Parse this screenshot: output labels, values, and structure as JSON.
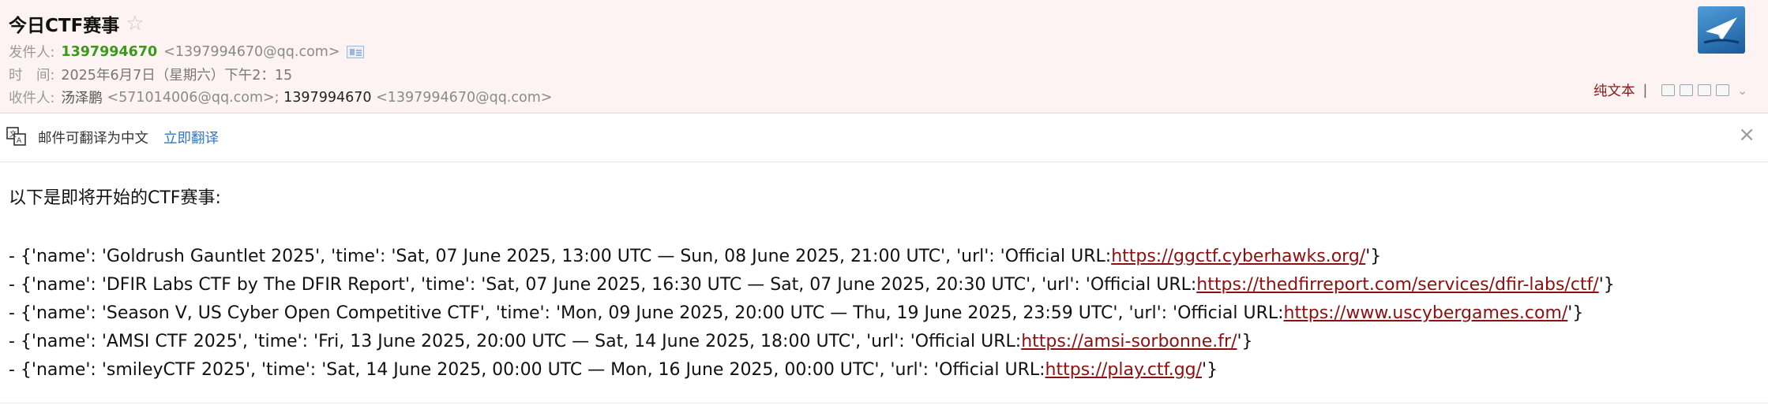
{
  "email": {
    "subject": "今日CTF赛事",
    "star_icon": "star-outline-icon",
    "from_label": "发件人:",
    "from_name": "1397994670",
    "from_address": "<1397994670@qq.com>",
    "time_label": "时　间:",
    "time_value": "2025年6月7日（星期六）下午2：15",
    "to_label": "收件人:",
    "to_name_1": "汤泽鹏",
    "to_address_1": "<571014006@qq.com>;",
    "to_name_2": "1397994670",
    "to_address_2": "<1397994670@qq.com>"
  },
  "toolbar": {
    "plain_text_label": "纯文本",
    "separator": "|",
    "icons": [
      "window-icon",
      "document-icon",
      "folder-add-icon",
      "printer-icon",
      "chevron-down-icon"
    ]
  },
  "translate": {
    "notice": "邮件可翻译为中文",
    "action": "立即翻译",
    "close": "×"
  },
  "body": {
    "intro": "以下是即将开始的CTF赛事:",
    "items": [
      {
        "text": "- {'name': 'Goldrush Gauntlet 2025', 'time': 'Sat, 07 June 2025, 13:00 UTC — Sun, 08 June 2025, 21:00 UTC', 'url': 'Official URL:",
        "link": "https://ggctf.cyberhawks.org/",
        "tail": "'}"
      },
      {
        "text": "- {'name': 'DFIR Labs CTF by The DFIR Report', 'time': 'Sat, 07 June 2025, 16:30 UTC — Sat, 07 June 2025, 20:30 UTC', 'url': 'Official URL:",
        "link": "https://thedfirreport.com/services/dfir-labs/ctf/",
        "tail": "'}"
      },
      {
        "text": "- {'name': 'Season V, US Cyber Open Competitive CTF', 'time': 'Mon, 09 June 2025, 20:00 UTC — Thu, 19 June 2025, 23:59 UTC', 'url': 'Official URL:",
        "link": "https://www.uscybergames.com/",
        "tail": "'}"
      },
      {
        "text": "- {'name': 'AMSI CTF 2025', 'time': 'Fri, 13 June 2025, 20:00 UTC — Sat, 14 June 2025, 18:00 UTC', 'url': 'Official URL:",
        "link": "https://amsi-sorbonne.fr/",
        "tail": "'}"
      },
      {
        "text": "- {'name': 'smileyCTF 2025', 'time': 'Sat, 14 June 2025, 00:00 UTC — Mon, 16 June 2025, 00:00 UTC', 'url': 'Official URL:",
        "link": "https://play.ctf.gg/",
        "tail": "'}"
      }
    ]
  }
}
